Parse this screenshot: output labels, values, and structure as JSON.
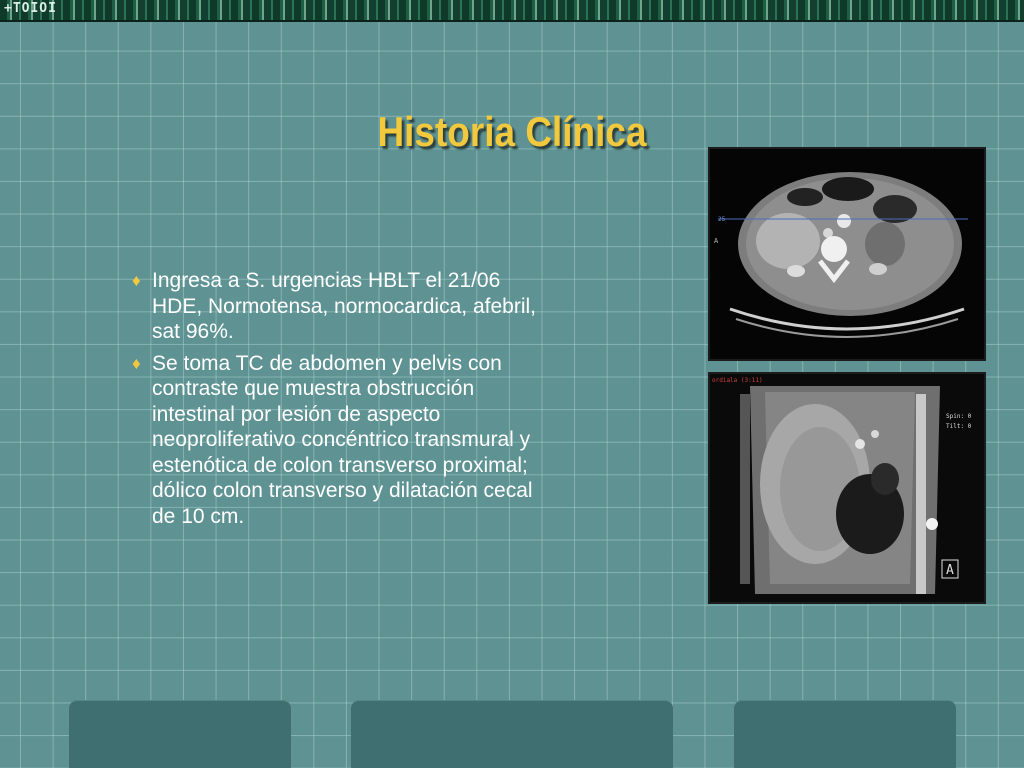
{
  "slide": {
    "title": "Historia Clínica",
    "bullets": [
      {
        "icon": "diamond-bullet-icon",
        "text": "Ingresa a S. urgencias HBLT el 21/06 HDE, Normotensa, normocardica, afebril, sat 96%."
      },
      {
        "icon": "diamond-bullet-icon",
        "text": "Se toma TC de abdomen y pelvis con contraste que muestra obstrucción intestinal por lesión de aspecto neoproliferativo concéntrico transmural y estenótica de colon transverso proximal; dólico colon transverso y dilatación cecal de 10 cm."
      }
    ]
  },
  "images": {
    "axial": {
      "marker": "A",
      "index": "25"
    },
    "coronal": {
      "header": "ordiala (3:11)",
      "spin": "Spin: 0",
      "tilt": "Tilt: 0",
      "marker": "A"
    }
  },
  "colors": {
    "background": "#5f9393",
    "title": "#f2c83c",
    "text": "#ffffff",
    "bullet": "#f2c83c",
    "footer_blocks": "#3f6f70"
  },
  "top_strip": {
    "text": "+TOIOI"
  }
}
